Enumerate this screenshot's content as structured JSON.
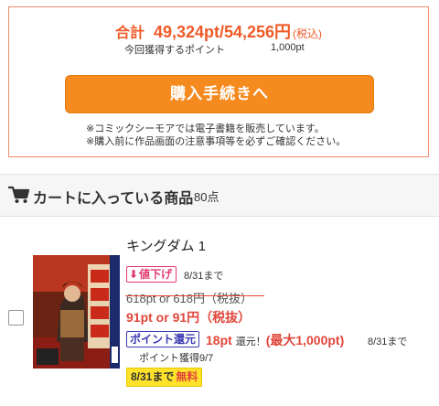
{
  "summary": {
    "total_label": "合計",
    "total_value": "49,324pt/54,256円",
    "tax_note": "(税込)",
    "points_label": "今回獲得するポイント",
    "points_value": "1,000pt",
    "checkout_label": "購入手続きへ",
    "notes": [
      "※コミックシーモアでは電子書籍を販売しています。",
      "※購入前に作品画面の注意事項等を必ずご確認ください。"
    ]
  },
  "cart": {
    "icon": "cart-icon",
    "title": "カートに入っている商品",
    "count": "80点",
    "items": [
      {
        "title": "キングダム 1",
        "cover_icon": "book-cover-kingdom",
        "discount_badge": "値下げ",
        "discount_until": "8/31まで",
        "original_price": "618pt or 618円（税抜）",
        "sale_price": "91pt or 91円（税抜）",
        "points_badge": "ポイント還元",
        "points_amount": "18pt",
        "points_suffix": "還元！",
        "points_max": "(最大1,000pt)",
        "points_until": "8/31まで",
        "points_grant": "ポイント獲得9/7",
        "free_until": "8/31まで",
        "free_label": "無料"
      }
    ]
  },
  "colors": {
    "accent": "#ef5a28",
    "button": "#f58a1f",
    "discount": "#e23b6f",
    "points_badge": "#3a3ab2",
    "free_badge": "#ffe32a"
  }
}
